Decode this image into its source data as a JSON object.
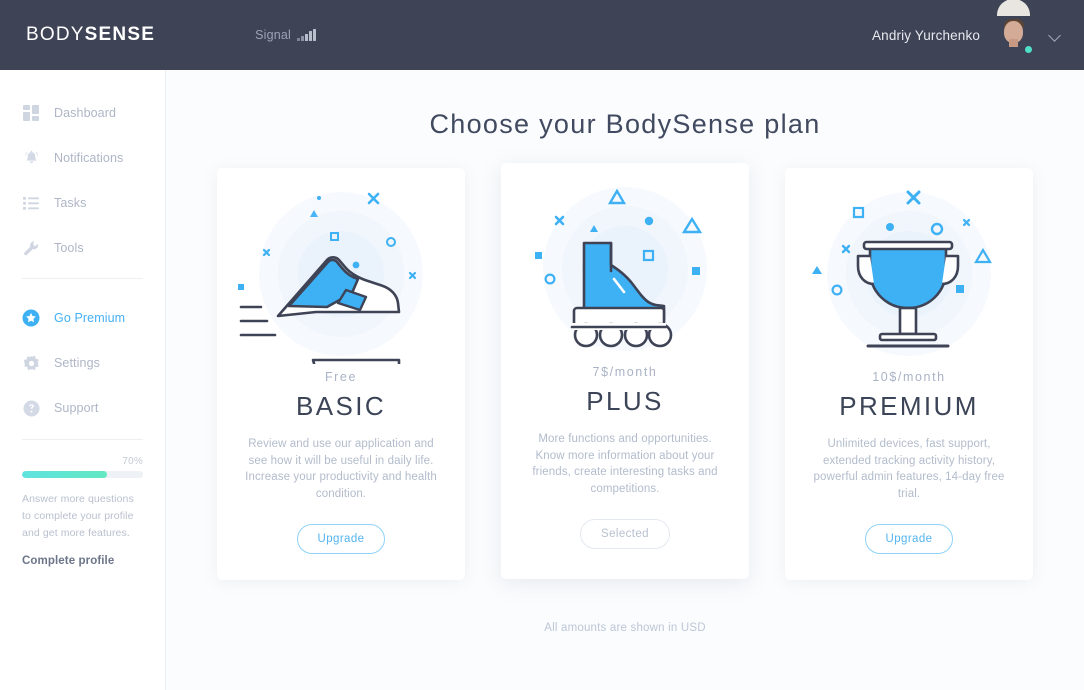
{
  "header": {
    "logo_thin": "BODY",
    "logo_bold": "SENSE",
    "signal_label": "Signal",
    "signal_icon": "signal-bars-icon",
    "user_name": "Andriy Yurchenko",
    "avatar_icon": "avatar",
    "status": "online",
    "chevron_icon": "chevron-down-icon"
  },
  "sidebar": {
    "items": [
      {
        "label": "Dashboard",
        "icon": "dashboard-grid-icon"
      },
      {
        "label": "Notifications",
        "icon": "bell-icon"
      },
      {
        "label": "Tasks",
        "icon": "list-icon"
      },
      {
        "label": "Tools",
        "icon": "wrench-icon"
      }
    ],
    "premium": {
      "label": "Go Premium",
      "icon": "star-badge-icon"
    },
    "secondary": [
      {
        "label": "Settings",
        "icon": "gear-icon"
      },
      {
        "label": "Support",
        "icon": "question-circle-icon"
      }
    ],
    "progress": {
      "percent_label": "70%",
      "percent_value": 70,
      "description": "Answer more questions to complete your profile and get more features.",
      "cta": "Complete profile"
    }
  },
  "main": {
    "title": "Choose your BodySense plan",
    "footnote": "All amounts are shown in USD",
    "plans": [
      {
        "price": "Free",
        "name": "BASIC",
        "description": "Review and use our application and see how it will be useful in daily life. Increase your productivity and health condition.",
        "button": "Upgrade",
        "button_state": "upgrade",
        "illustration": "sneaker-icon"
      },
      {
        "price": "7$/month",
        "name": "PLUS",
        "description": "More functions and opportunities. Know more information about your friends, create interesting tasks and competitions.",
        "button": "Selected",
        "button_state": "selected",
        "illustration": "roller-skate-icon"
      },
      {
        "price": "10$/month",
        "name": "PREMIUM",
        "description": "Unlimited devices, fast support, extended tracking activity history, powerful admin features, 14-day free trial.",
        "button": "Upgrade",
        "button_state": "upgrade",
        "illustration": "trophy-icon"
      }
    ]
  },
  "colors": {
    "header_bg": "#3e4356",
    "accent_blue": "#3eb1f5",
    "ink": "#3c4457",
    "muted": "#b2bccc",
    "status_green": "#4fe0c8"
  }
}
